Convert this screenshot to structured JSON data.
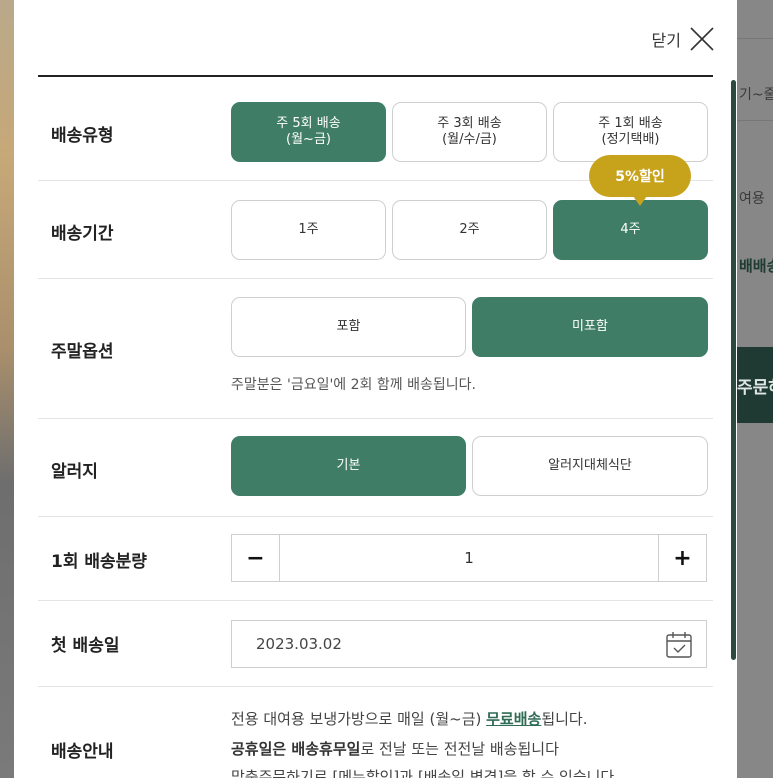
{
  "background": {
    "texts": [
      "기~줄",
      "여용",
      "배배송",
      "주문하"
    ]
  },
  "modal": {
    "close_label": "닫기",
    "delivery_type": {
      "label": "배송유형",
      "options": [
        {
          "line1": "주 5회 배송",
          "line2": "(월~금)",
          "selected": true
        },
        {
          "line1": "주 3회 배송",
          "line2": "(월/수/금)",
          "selected": false
        },
        {
          "line1": "주 1회 배송",
          "line2": "(정기택배)",
          "selected": false
        }
      ]
    },
    "delivery_period": {
      "label": "배송기간",
      "badge": "5%할인",
      "options": [
        {
          "label": "1주",
          "selected": false
        },
        {
          "label": "2주",
          "selected": false
        },
        {
          "label": "4주",
          "selected": true
        }
      ]
    },
    "weekend_option": {
      "label": "주말옵션",
      "options": [
        {
          "label": "포함",
          "selected": false
        },
        {
          "label": "미포함",
          "selected": true
        }
      ],
      "note": "주말분은 '금요일'에 2회 함께 배송됩니다."
    },
    "allergy": {
      "label": "알러지",
      "options": [
        {
          "label": "기본",
          "selected": true
        },
        {
          "label": "알러지대체식단",
          "selected": false
        }
      ]
    },
    "quantity": {
      "label": "1회 배송분량",
      "minus": "−",
      "plus": "+",
      "value": "1"
    },
    "first_delivery": {
      "label": "첫 배송일",
      "date": "2023.03.02",
      "icon": "calendar-icon"
    },
    "delivery_info": {
      "label": "배송안내",
      "line1_pre": "전용 대여용 보냉가방으로 매일 (월~금) ",
      "line1_accent": "무료배송",
      "line1_post": "됩니다.",
      "line2_bold": "공휴일은 배송휴무일",
      "line2_post": "로 전날 또는 전전날 배송됩니다",
      "line3": "맞춤주문하기로 [메뉴할인]과 [배송일 변경]을 할 수 있습니다."
    }
  },
  "colors": {
    "accent": "#3f7d67",
    "badge": "#c7a21b",
    "scroll": "#2c4a42"
  }
}
